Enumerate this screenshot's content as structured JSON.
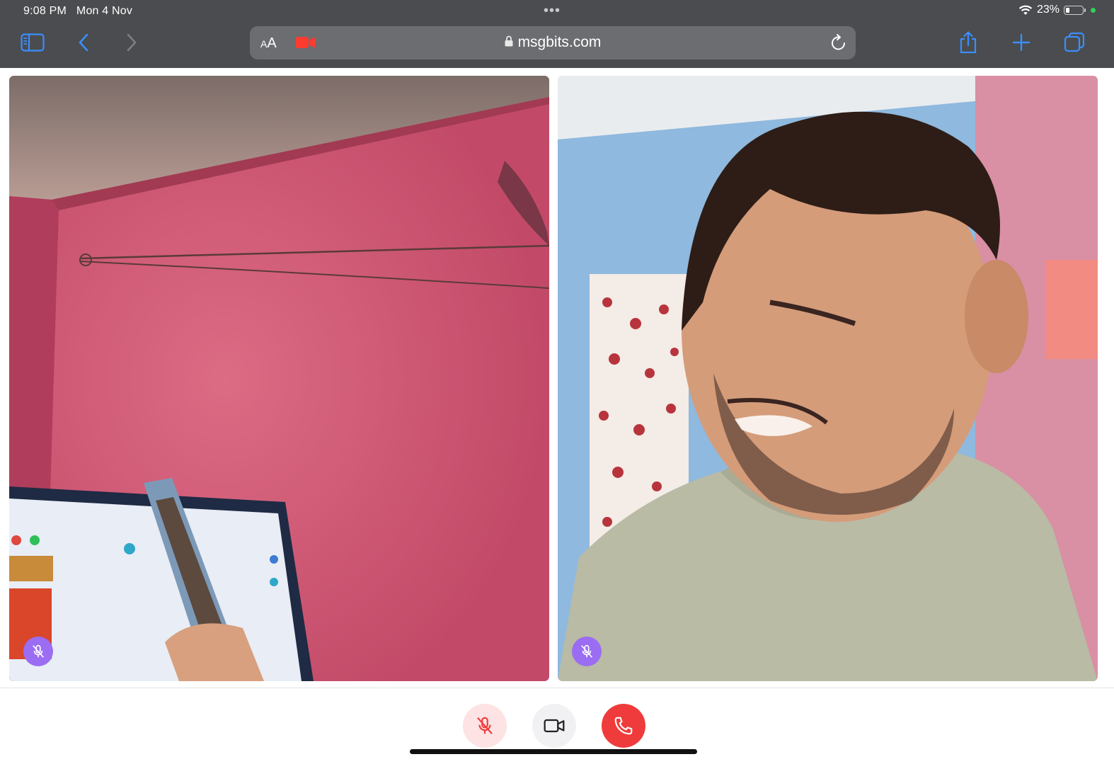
{
  "status_bar": {
    "time_date": "9:08 PM   Mon 4 Nov",
    "battery_text": "23%",
    "battery_level": 0.23
  },
  "browser": {
    "text_size_label_small": "A",
    "text_size_label_large": "A",
    "url": "msgbits.com",
    "icons": [
      "sidebar-icon",
      "back-icon",
      "forward-icon",
      "camera-recording-icon",
      "lock-icon",
      "reload-icon",
      "share-icon",
      "new-tab-icon",
      "tabs-icon"
    ]
  },
  "call": {
    "participants": [
      {
        "name": "",
        "muted": true
      },
      {
        "name": "",
        "muted": true
      }
    ],
    "controls": {
      "mic": {
        "icon": "mic-off-icon",
        "muted": true
      },
      "camera": {
        "icon": "video-camera-icon"
      },
      "end": {
        "icon": "phone-hangup-icon"
      }
    }
  },
  "colors": {
    "chrome_bg": "#4a4c4f",
    "accent_blue": "#2f8cff",
    "mute_badge": "#9b6df2",
    "end_call": "#ef3b3b",
    "mic_muted_bg": "#fde3e3",
    "recording_red": "#ff3b30"
  }
}
